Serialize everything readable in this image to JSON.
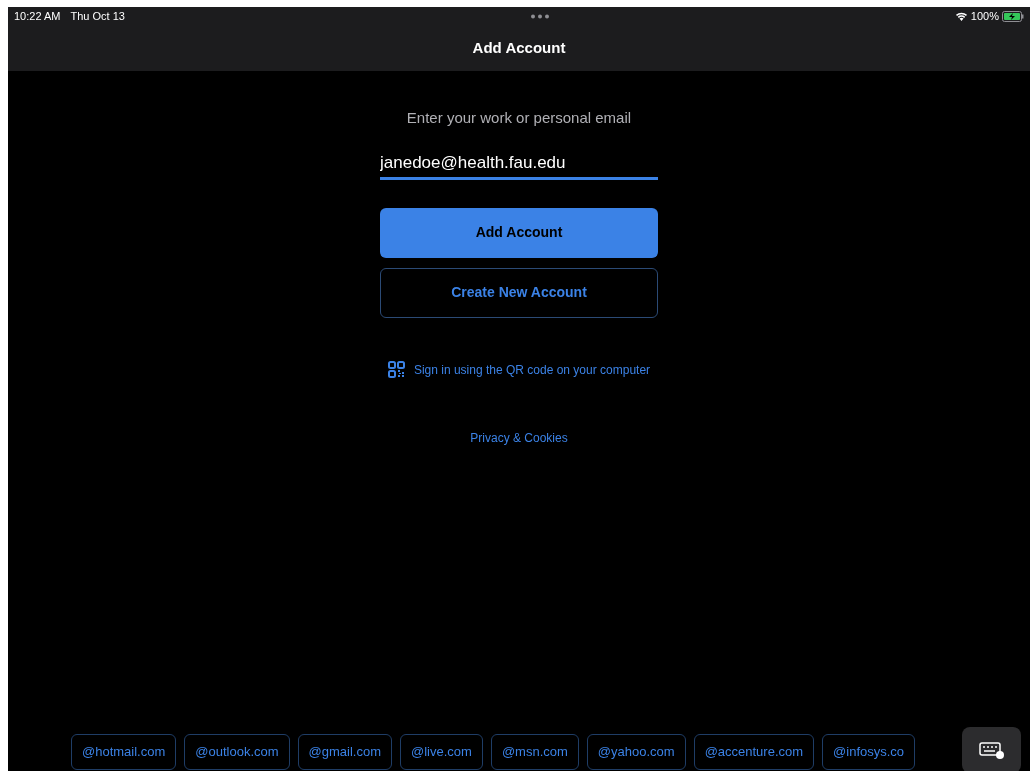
{
  "status_bar": {
    "time": "10:22 AM",
    "date": "Thu Oct 13",
    "battery": "100%",
    "charging": true
  },
  "nav_bar": {
    "title": "Add Account"
  },
  "form": {
    "prompt": "Enter your work or personal email",
    "email": {
      "value": "janedoe@health.fau.edu",
      "focused": true
    },
    "buttons": [
      {
        "label": "Add Account",
        "kind": "primary"
      },
      {
        "label": "Create New Account",
        "kind": "outline"
      }
    ],
    "qr_link": "Sign in using the QR code on your computer",
    "privacy_link": "Privacy & Cookies"
  },
  "domain_suggestions": [
    "@hotmail.com",
    "@outlook.com",
    "@gmail.com",
    "@live.com",
    "@msn.com",
    "@yahoo.com",
    "@accenture.com",
    "@infosys.co"
  ]
}
